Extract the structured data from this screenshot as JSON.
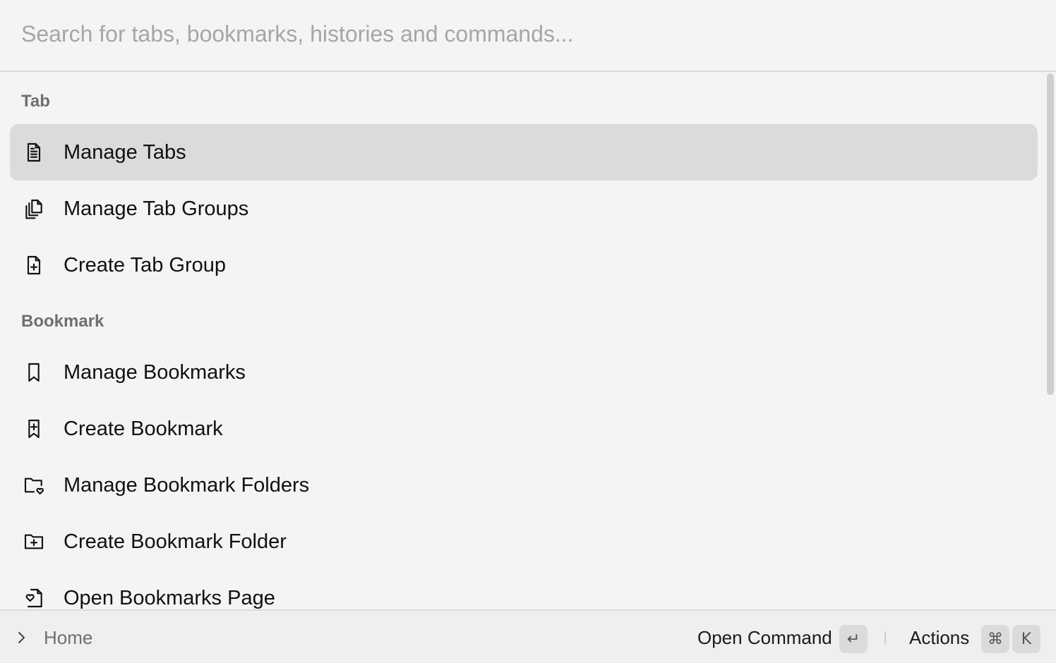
{
  "search": {
    "placeholder": "Search for tabs, bookmarks, histories and commands..."
  },
  "sections": [
    {
      "label": "Tab"
    },
    {
      "label": "Bookmark"
    }
  ],
  "items": [
    {
      "label": "Manage Tabs",
      "icon": "document-icon",
      "selected": true
    },
    {
      "label": "Manage Tab Groups",
      "icon": "documents-stack-icon",
      "selected": false
    },
    {
      "label": "Create Tab Group",
      "icon": "document-plus-icon",
      "selected": false
    },
    {
      "label": "Manage Bookmarks",
      "icon": "bookmark-icon",
      "selected": false
    },
    {
      "label": "Create Bookmark",
      "icon": "bookmark-plus-icon",
      "selected": false
    },
    {
      "label": "Manage Bookmark Folders",
      "icon": "folder-heart-icon",
      "selected": false
    },
    {
      "label": "Create Bookmark Folder",
      "icon": "folder-plus-icon",
      "selected": false
    },
    {
      "label": "Open Bookmarks Page",
      "icon": "document-heart-icon",
      "selected": false
    }
  ],
  "footer": {
    "breadcrumb": "Home",
    "primary_action": "Open Command",
    "primary_key": "↵",
    "secondary_action": "Actions",
    "secondary_keys": [
      "⌘",
      "K"
    ]
  },
  "colors": {
    "background": "#f4f4f4",
    "selected_row": "#dcdbda",
    "footer_bg": "#f0efee",
    "muted_text": "#6f6f6f"
  }
}
